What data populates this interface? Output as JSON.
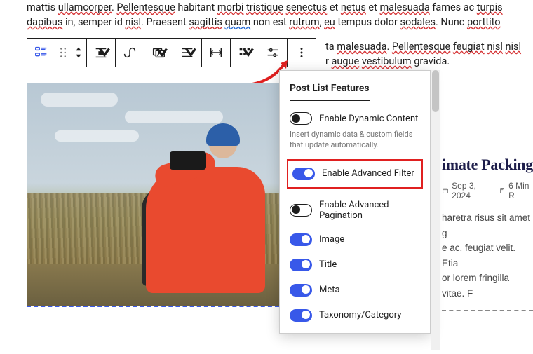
{
  "paragraph": {
    "line1a": "mattis ",
    "line1b": "ullamcorper",
    "line1c": ". ",
    "line1d": "Pellentesque",
    "line1e": " habitant ",
    "line1f": "morbi",
    "line1g": " ",
    "line1h": "tristique",
    "line1i": " ",
    "line1j": "senectus",
    "line1k": " et ",
    "line1l": "netus",
    "line1m": " et ",
    "line1n": "malesuada",
    "line1o": " fames ac ",
    "line1p": "turpis",
    "line2a": "dapibus",
    "line2b": " in, semper id ",
    "line2c": "nisl",
    "line2d": ". Praesent ",
    "line2e": "sagittis",
    "line2f": " ",
    "line2g": "quam",
    "line2h": " non est ",
    "line2i": "rutrum",
    "line2j": ", ",
    "line2k": "eu",
    "line2l": " tempus dolor ",
    "line2m": "sodales",
    "line2n": ". Nunc ",
    "line2o": "porttito",
    "line3a": "ta ",
    "line3b": "malesuada",
    "line3c": ". ",
    "line3d": "Pellentesque",
    "line3e": " ",
    "line3f": "feugiat",
    "line3g": " ",
    "line3h": "nisl",
    "line3i": " ",
    "line3j": "nisl",
    "line4a": "r ",
    "line4b": "augue",
    "line4c": " ",
    "line4d": "vestibulum",
    "line4e": " gravida."
  },
  "dropdown": {
    "title": "Post List Features",
    "items": [
      {
        "label": "Enable Dynamic Content",
        "on": false
      },
      {
        "label": "Enable Advanced Filter",
        "on": true
      },
      {
        "label": "Enable Advanced Pagination",
        "on": false
      },
      {
        "label": "Image",
        "on": true
      },
      {
        "label": "Title",
        "on": true
      },
      {
        "label": "Meta",
        "on": true
      },
      {
        "label": "Taxonomy/Category",
        "on": true
      }
    ],
    "help": "Insert dynamic data & custom fields that update automatically."
  },
  "right_card": {
    "title": "imate Packing",
    "date": "Sep 3, 2024",
    "read": "6 Min R",
    "excerpt_l1": "haretra risus sit amet g",
    "excerpt_l2": "e ac, feugiat velit. Etia",
    "excerpt_l3": "or lorem fringilla vitae. F"
  }
}
